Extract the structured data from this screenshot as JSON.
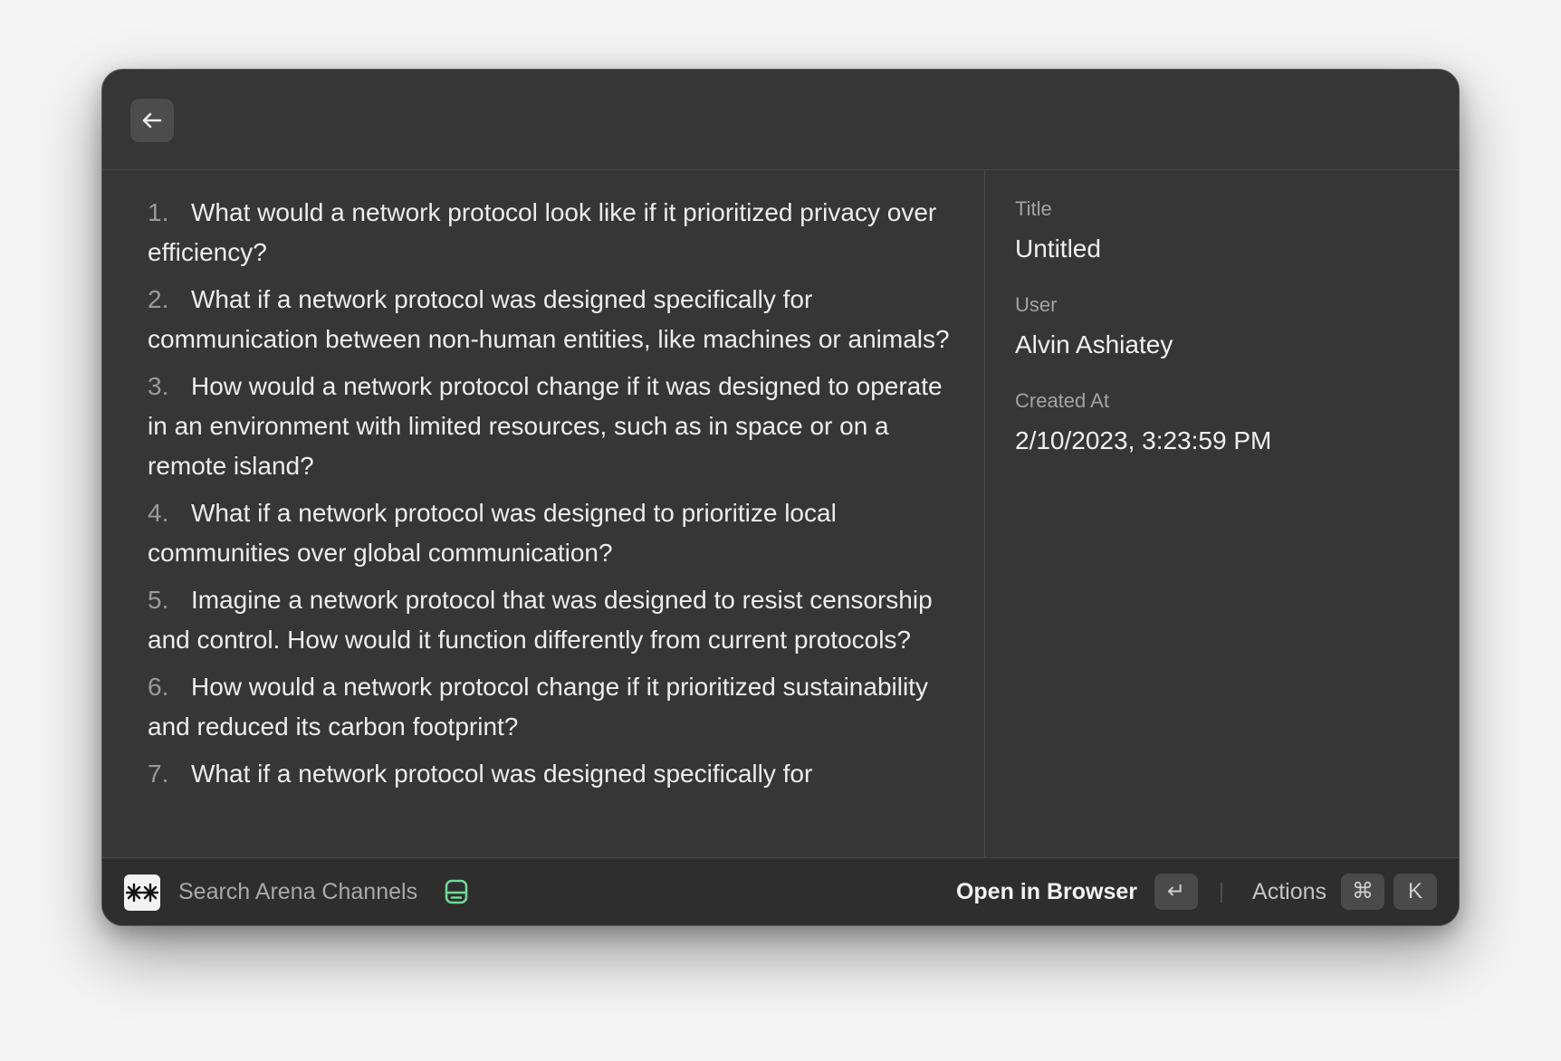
{
  "header": {
    "back_icon": "arrow-left-icon"
  },
  "content": {
    "items": [
      {
        "number": "1.",
        "text": "What would a network protocol look like if it prioritized privacy over efficiency?"
      },
      {
        "number": "2.",
        "text": "What if a network protocol was designed specifically for communication between non-human entities, like machines or animals?"
      },
      {
        "number": "3.",
        "text": "How would a network protocol change if it was designed to operate in an environment with limited resources, such as in space or on a remote island?"
      },
      {
        "number": "4.",
        "text": "What if a network protocol was designed to prioritize local communities over global communication?"
      },
      {
        "number": "5.",
        "text": "Imagine a network protocol that was designed to resist censorship and control. How would it function differently from current protocols?"
      },
      {
        "number": "6.",
        "text": "How would a network protocol change if it prioritized sustainability and reduced its carbon footprint?"
      },
      {
        "number": "7.",
        "text": "What if a network protocol was designed specifically for"
      }
    ]
  },
  "metadata": {
    "title_label": "Title",
    "title_value": "Untitled",
    "user_label": "User",
    "user_value": "Alvin Ashiatey",
    "created_label": "Created At",
    "created_value": "2/10/2023, 3:23:59 PM"
  },
  "footer": {
    "app_icon": "arena-logo-icon",
    "title": "Search Arena Channels",
    "status_icon": "drive-icon",
    "status_color": "#6fd89a",
    "primary_action": "Open in Browser",
    "primary_shortcut": "↵",
    "actions_label": "Actions",
    "actions_shortcut_mod": "⌘",
    "actions_shortcut_key": "K"
  }
}
